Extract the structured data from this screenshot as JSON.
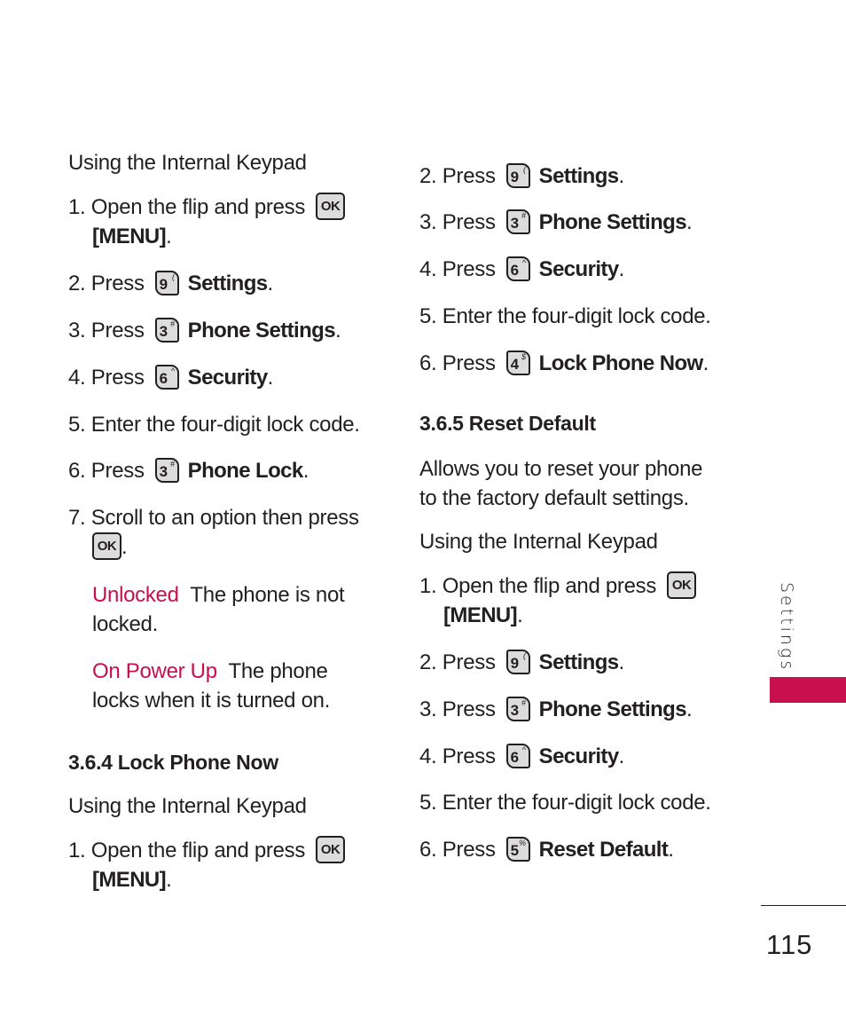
{
  "left": {
    "sub1": "Using the Internal Keypad",
    "s1_num": "1.",
    "s1_text": "Open the flip and press",
    "s1_key": "OK",
    "s1_cont": "[MENU]",
    "s2_num": "2.",
    "s2_text": "Press",
    "s2_key_d": "9",
    "s2_key_s": "(",
    "s2_label": "Settings",
    "s3_num": "3.",
    "s3_text": "Press",
    "s3_key_d": "3",
    "s3_key_s": "#",
    "s3_label": "Phone Settings",
    "s4_num": "4.",
    "s4_text": "Press",
    "s4_key_d": "6",
    "s4_key_s": "^",
    "s4_label": "Security",
    "s5_num": "5.",
    "s5_text": "Enter the four-digit lock code.",
    "s6_num": "6.",
    "s6_text": "Press",
    "s6_key_d": "3",
    "s6_key_s": "#",
    "s6_label": "Phone Lock",
    "s7_num": "7.",
    "s7_text": "Scroll to an option then press",
    "s7_key": "OK",
    "opt1_term": "Unlocked",
    "opt1_desc1": "The phone is not",
    "opt1_desc2": "locked.",
    "opt2_term": "On Power Up",
    "opt2_desc1": "The phone",
    "opt2_desc2": "locks when it is turned on.",
    "sec364": "3.6.4 Lock Phone Now",
    "sub2": "Using the Internal Keypad",
    "t1_num": "1.",
    "t1_text": "Open the flip and press",
    "t1_key": "OK",
    "t1_cont": "[MENU]"
  },
  "right": {
    "a2_num": "2.",
    "a2_text": "Press",
    "a2_key_d": "9",
    "a2_key_s": "(",
    "a2_label": "Settings",
    "a3_num": "3.",
    "a3_text": "Press",
    "a3_key_d": "3",
    "a3_key_s": "#",
    "a3_label": "Phone Settings",
    "a4_num": "4.",
    "a4_text": "Press",
    "a4_key_d": "6",
    "a4_key_s": "^",
    "a4_label": "Security",
    "a5_num": "5.",
    "a5_text": "Enter the four-digit lock code.",
    "a6_num": "6.",
    "a6_text": "Press",
    "a6_key_d": "4",
    "a6_key_s": "$",
    "a6_label": "Lock Phone Now",
    "sec365": "3.6.5 Reset Default",
    "desc1": "Allows you to reset your phone",
    "desc2": "to the factory default settings.",
    "sub": "Using the Internal Keypad",
    "b1_num": "1.",
    "b1_text": "Open the flip and press",
    "b1_key": "OK",
    "b1_cont": "[MENU]",
    "b2_num": "2.",
    "b2_text": "Press",
    "b2_key_d": "9",
    "b2_key_s": "(",
    "b2_label": "Settings",
    "b3_num": "3.",
    "b3_text": "Press",
    "b3_key_d": "3",
    "b3_key_s": "#",
    "b3_label": "Phone Settings",
    "b4_num": "4.",
    "b4_text": "Press",
    "b4_key_d": "6",
    "b4_key_s": "^",
    "b4_label": "Security",
    "b5_num": "5.",
    "b5_text": "Enter the four-digit lock code.",
    "b6_num": "6.",
    "b6_text": "Press",
    "b6_key_d": "5",
    "b6_key_s": "%",
    "b6_label": "Reset Default"
  },
  "sidebar": {
    "label": "Settings",
    "accent_color": "#c8104e"
  },
  "footer": {
    "page_number": "115"
  },
  "punct": {
    "period": "."
  }
}
